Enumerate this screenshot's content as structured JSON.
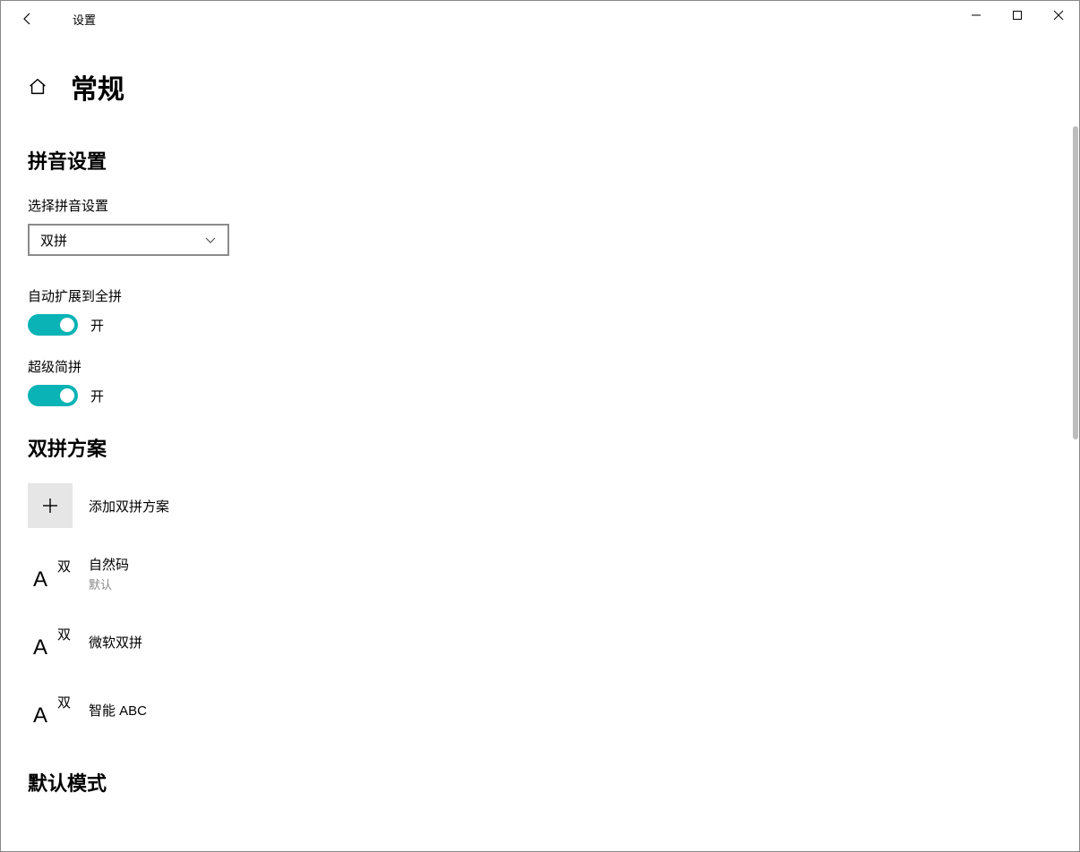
{
  "window": {
    "title": "设置"
  },
  "header": {
    "page_title": "常规"
  },
  "pinyin_section": {
    "title": "拼音设置",
    "select_label": "选择拼音设置",
    "select_value": "双拼",
    "auto_expand": {
      "label": "自动扩展到全拼",
      "state_text": "开"
    },
    "super_simple": {
      "label": "超级简拼",
      "state_text": "开"
    }
  },
  "scheme_section": {
    "title": "双拼方案",
    "add_label": "添加双拼方案",
    "icon_tag": "双",
    "schemes": [
      {
        "name": "自然码",
        "sub": "默认"
      },
      {
        "name": "微软双拼",
        "sub": ""
      },
      {
        "name": "智能 ABC",
        "sub": ""
      }
    ]
  },
  "default_mode_section": {
    "title": "默认模式"
  }
}
